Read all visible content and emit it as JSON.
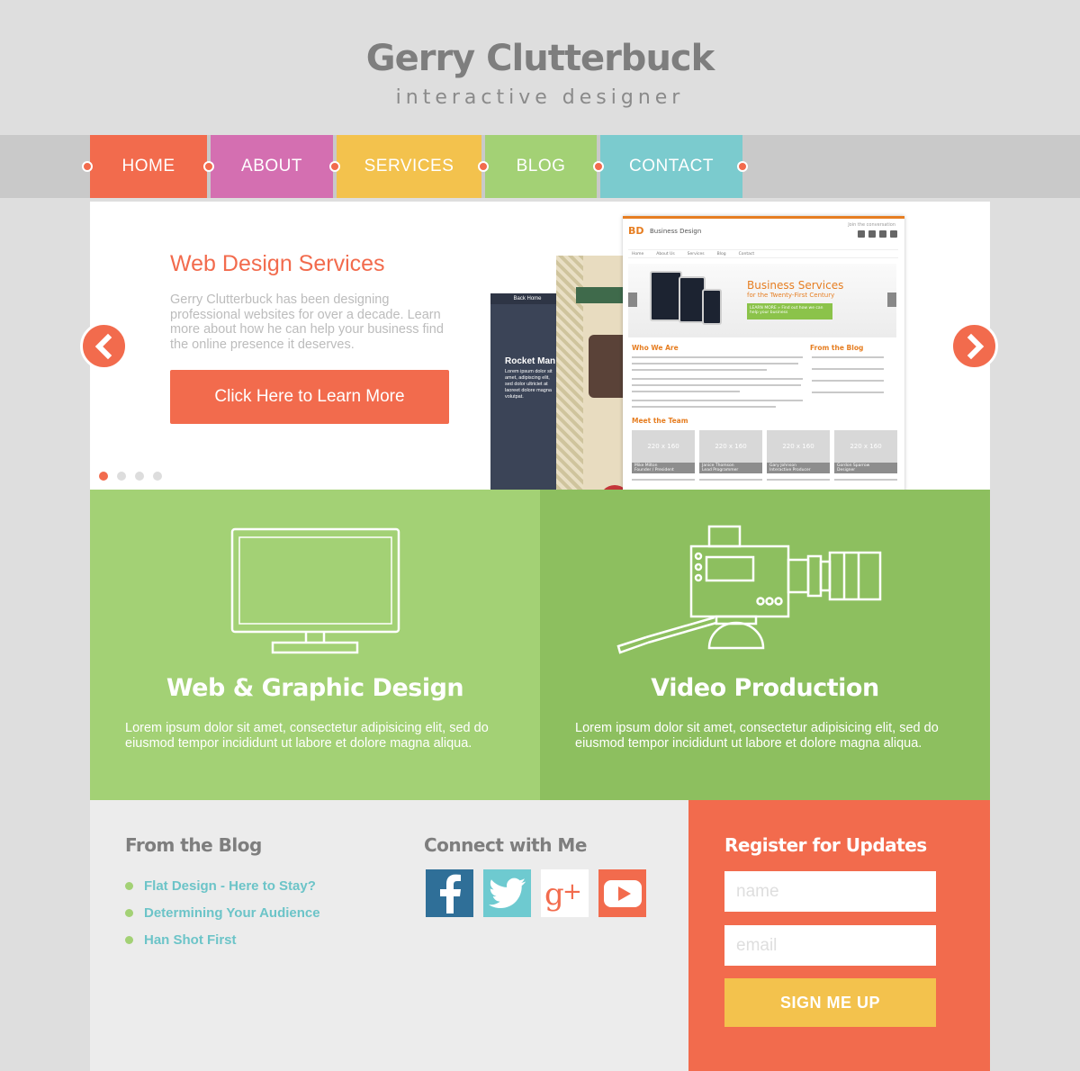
{
  "header": {
    "title": "Gerry Clutterbuck",
    "tagline": "interactive designer"
  },
  "nav": {
    "items": [
      {
        "label": "HOME",
        "color": "#f26b4d"
      },
      {
        "label": "ABOUT",
        "color": "#d46fb1"
      },
      {
        "label": "SERVICES",
        "color": "#f3c24d"
      },
      {
        "label": "BLOG",
        "color": "#a3d175"
      },
      {
        "label": "CONTACT",
        "color": "#7bcbce"
      }
    ]
  },
  "slider": {
    "title": "Web Design Services",
    "text": "Gerry Clutterbuck has been designing professional websites for over a decade. Learn more about how he can help your business find the online presence it deserves.",
    "cta_label": "Click Here to Learn More",
    "dots_count": 4,
    "active_dot": 1,
    "prev_icon": "chevron-left-icon",
    "next_icon": "chevron-right-icon",
    "mockups": {
      "dark": {
        "nav": "Back Home",
        "heading": "Rocket Man",
        "text": "Lorem ipsum dolor sit amet, adipiscing elit, sed dolor ultriciet at laoreet dolore magna volutpat."
      },
      "site": {
        "logo": "BD",
        "name": "Business Design",
        "join": "Join the conversation",
        "nav": [
          "Home",
          "About Us",
          "Services",
          "Blog",
          "Contact"
        ],
        "hero_title": "Business Services",
        "hero_sub": "for the Twenty-First Century",
        "hero_btn": "LEARN MORE »  Find out how we can help your business",
        "who": "Who We Are",
        "blog": "From the Blog",
        "team": "Meet the Team",
        "cards": [
          {
            "size": "220 x 160",
            "name": "Mike Milton",
            "role": "Founder / President"
          },
          {
            "size": "220 x 160",
            "name": "Janice Thomson",
            "role": "Lead Programmer"
          },
          {
            "size": "220 x 160",
            "name": "Gary Johnson",
            "role": "Interactive Producer"
          },
          {
            "size": "220 x 160",
            "name": "Gordon Sparrow",
            "role": "Designer"
          }
        ]
      }
    }
  },
  "services": [
    {
      "title": "Web & Graphic Design",
      "text": "Lorem ipsum dolor sit amet, consectetur adipisicing elit, sed do eiusmod tempor incididunt ut labore et dolore magna aliqua.",
      "icon": "monitor-icon"
    },
    {
      "title": "Video Production",
      "text": "Lorem ipsum dolor sit amet, consectetur adipisicing elit, sed do eiusmod tempor incididunt ut labore et dolore magna aliqua.",
      "icon": "video-camera-icon"
    }
  ],
  "footer": {
    "blog": {
      "heading": "From the Blog",
      "posts": [
        "Flat Design - Here to Stay?",
        "Determining Your Audience",
        "Han Shot First"
      ]
    },
    "connect": {
      "heading": "Connect with Me",
      "networks": [
        "facebook-icon",
        "twitter-icon",
        "google-plus-icon",
        "youtube-icon"
      ]
    },
    "register": {
      "heading": "Register for Updates",
      "name_placeholder": "name",
      "email_placeholder": "email",
      "button_label": "SIGN ME UP"
    }
  },
  "colors": {
    "accent": "#f26b4d",
    "green": "#a3d175",
    "green_dark": "#8dbf5f",
    "teal": "#7bcbce",
    "yellow": "#f3c24d",
    "pink": "#d46fb1"
  }
}
